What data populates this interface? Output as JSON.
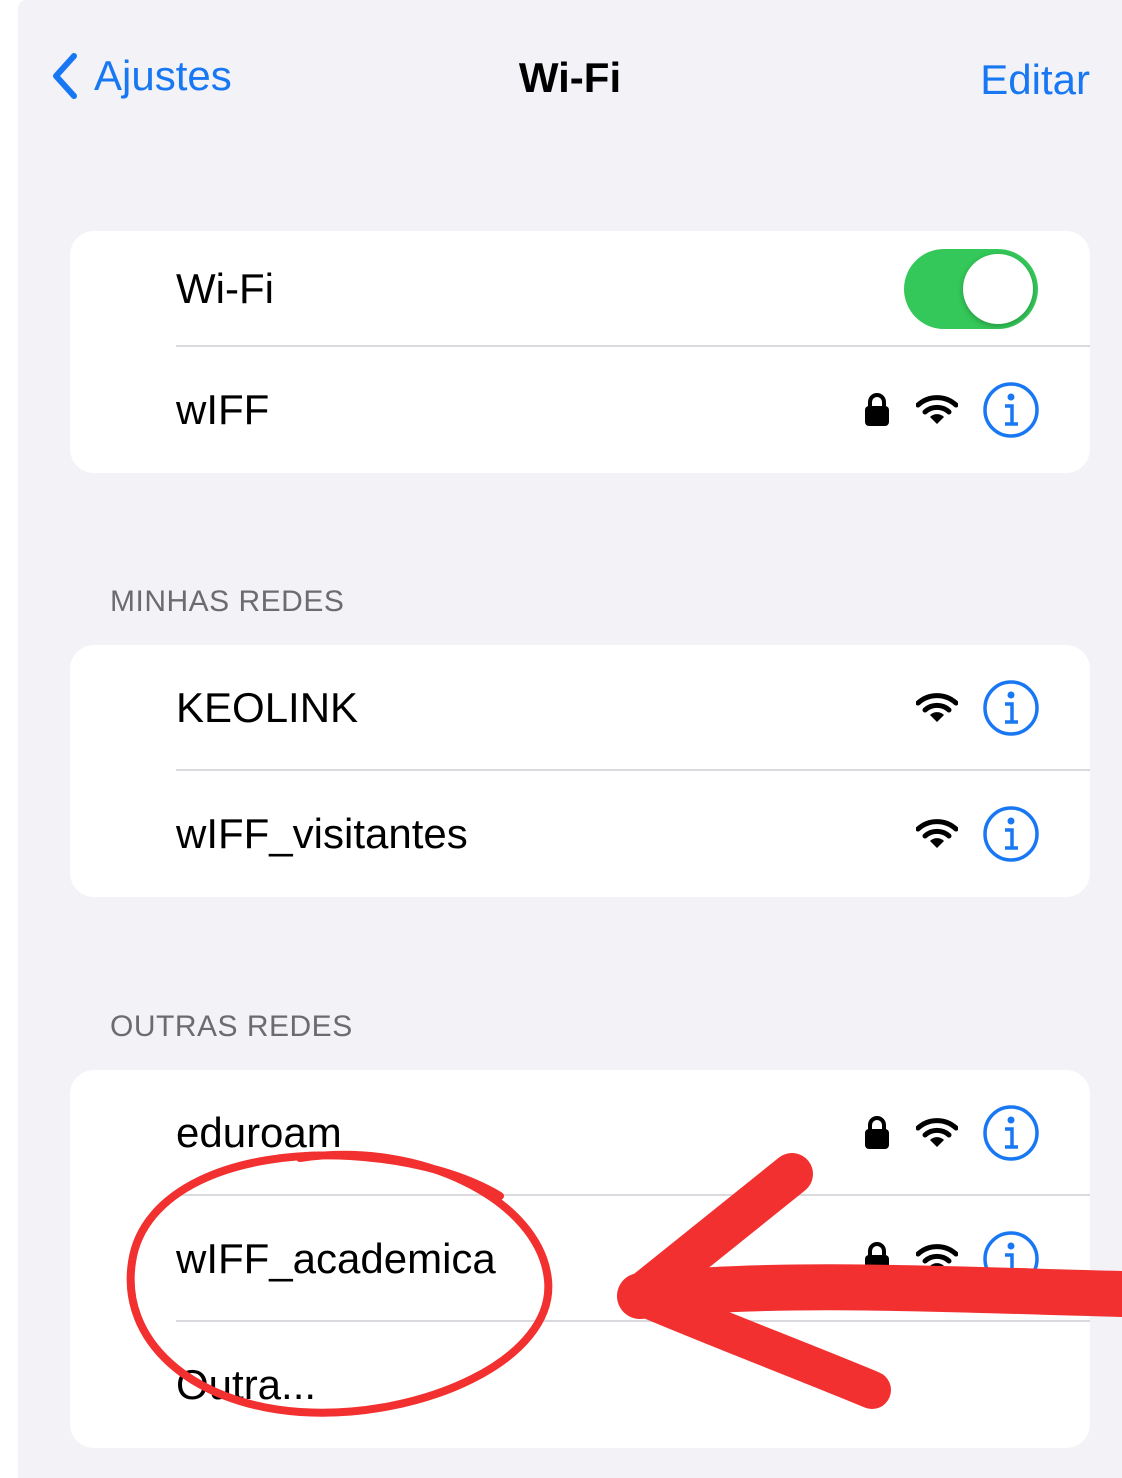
{
  "colors": {
    "accent": "#1877f2",
    "toggle_on": "#34c759",
    "annotation": "#f2302f"
  },
  "navbar": {
    "back_label": "Ajustes",
    "title": "Wi-Fi",
    "edit_label": "Editar"
  },
  "wifi_group": {
    "toggle_label": "Wi-Fi",
    "toggle_on": true,
    "connected_network": "wIFF"
  },
  "my_networks": {
    "header": "MINHAS REDES",
    "items": [
      {
        "name": "KEOLINK",
        "secured": false
      },
      {
        "name": "wIFF_visitantes",
        "secured": false
      }
    ]
  },
  "other_networks": {
    "header": "OUTRAS REDES",
    "items": [
      {
        "name": "eduroam",
        "secured": true
      },
      {
        "name": "wIFF_academica",
        "secured": true
      }
    ],
    "other_label": "Outra..."
  },
  "icons": [
    "chevron-left-icon",
    "lock-icon",
    "wifi-icon",
    "info-icon"
  ]
}
